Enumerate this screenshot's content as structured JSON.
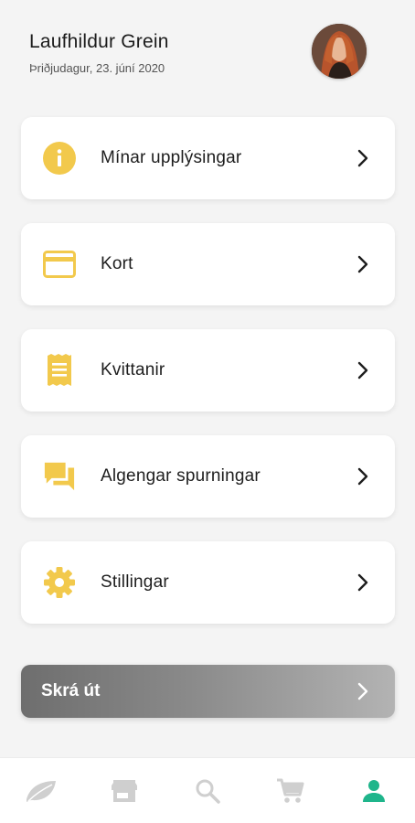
{
  "user": {
    "name": "Laufhildur Grein",
    "date": "Þriðjudagur, 23. júní 2020"
  },
  "menu": {
    "items": [
      {
        "label": "Mínar upplýsingar",
        "icon": "info-icon"
      },
      {
        "label": "Kort",
        "icon": "credit-card-icon"
      },
      {
        "label": "Kvittanir",
        "icon": "receipt-icon"
      },
      {
        "label": "Algengar spurningar",
        "icon": "chat-icon"
      },
      {
        "label": "Stillingar",
        "icon": "gear-icon"
      }
    ]
  },
  "logout": {
    "label": "Skrá út"
  },
  "bottom_nav": {
    "items": [
      {
        "icon": "leaf-icon",
        "active": false
      },
      {
        "icon": "store-icon",
        "active": false
      },
      {
        "icon": "search-icon",
        "active": false
      },
      {
        "icon": "cart-icon",
        "active": false
      },
      {
        "icon": "profile-icon",
        "active": true
      }
    ]
  },
  "colors": {
    "accent": "#f2c94c",
    "active_nav": "#1fb58b",
    "inactive_nav": "#cfcfcf",
    "background": "#f4f4f4"
  }
}
